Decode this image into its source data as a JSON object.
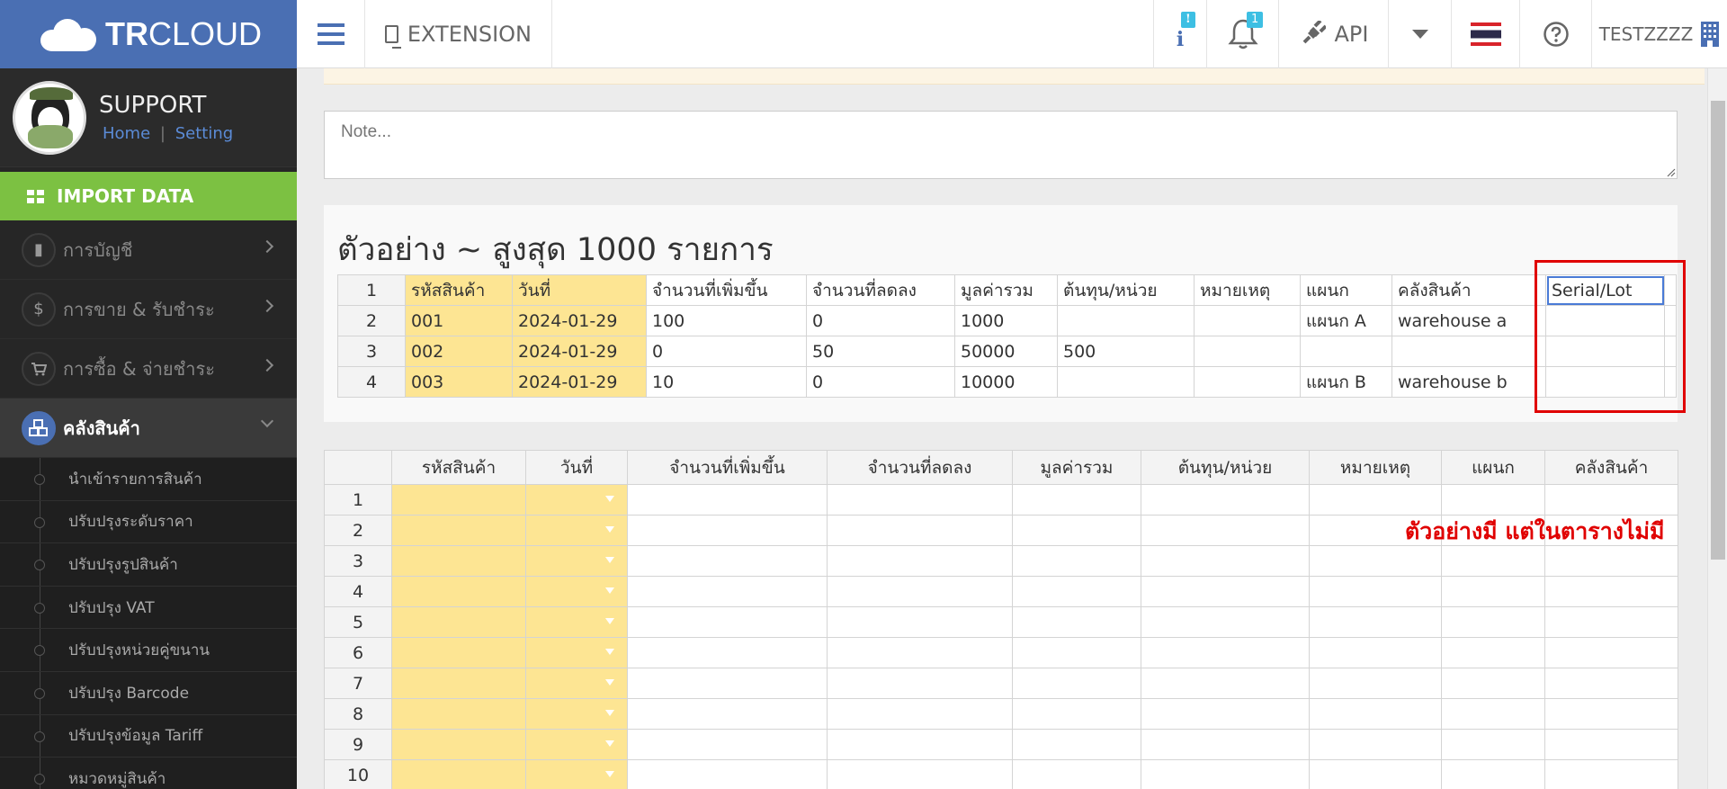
{
  "logo": {
    "part1": "TR",
    "part2": "CLOUD"
  },
  "topbar": {
    "extension_label": "EXTENSION",
    "info_badge": "!",
    "notification_badge": "1",
    "api_label": "API",
    "username": "TESTZZZZ"
  },
  "profile": {
    "name": "SUPPORT",
    "home_link": "Home",
    "separator": "|",
    "setting_link": "Setting"
  },
  "sidebar": {
    "import_data": "IMPORT DATA",
    "menus": [
      {
        "label": "การบัญชี",
        "icon": "book-icon"
      },
      {
        "label": "การขาย & รับชำระ",
        "icon": "dollar-icon"
      },
      {
        "label": "การซื้อ & จ่ายชำระ",
        "icon": "cart-icon"
      }
    ],
    "warehouse": "คลังสินค้า",
    "sub_items": [
      "นำเข้ารายการสินค้า",
      "ปรับปรุงระดับราคา",
      "ปรับปรุงรูปสินค้า",
      "ปรับปรุง VAT",
      "ปรับปรุงหน่วยคู่ขนาน",
      "ปรับปรุง Barcode",
      "ปรับปรุงข้อมูล Tariff",
      "หมวดหมู่สินค้า"
    ]
  },
  "note": {
    "placeholder": "Note..."
  },
  "sample": {
    "title": "ตัวอย่าง ~ สูงสุด 1000 รายการ",
    "rows": [
      {
        "n": "1",
        "cells": [
          "รหัสสินค้า",
          "วันที่",
          "จำนวนที่เพิ่มขึ้น",
          "จำนวนที่ลดลง",
          "มูลค่ารวม",
          "ต้นทุน/หน่วย",
          "หมายเหตุ",
          "แผนก",
          "คลังสินค้า",
          "Serial/Lot"
        ]
      },
      {
        "n": "2",
        "cells": [
          "001",
          "2024-01-29",
          "100",
          "0",
          "1000",
          "",
          "",
          "แผนก A",
          "warehouse a",
          ""
        ]
      },
      {
        "n": "3",
        "cells": [
          "002",
          "2024-01-29",
          "0",
          "50",
          "50000",
          "500",
          "",
          "",
          "",
          ""
        ]
      },
      {
        "n": "4",
        "cells": [
          "003",
          "2024-01-29",
          "10",
          "0",
          "10000",
          "",
          "",
          "แผนก B",
          "warehouse b",
          ""
        ]
      }
    ]
  },
  "grid": {
    "headers": [
      "รหัสสินค้า",
      "วันที่",
      "จำนวนที่เพิ่มขึ้น",
      "จำนวนที่ลดลง",
      "มูลค่ารวม",
      "ต้นทุน/หน่วย",
      "หมายเหตุ",
      "แผนก",
      "คลังสินค้า"
    ],
    "row_numbers": [
      "1",
      "2",
      "3",
      "4",
      "5",
      "6",
      "7",
      "8",
      "9",
      "10"
    ]
  },
  "annotation": "ตัวอย่างมี แต่ในตารางไม่มี",
  "colors": {
    "brand": "#4a6fb3",
    "import_green": "#7cc142",
    "highlight_yellow": "#fde593",
    "annotation_red": "#e00000"
  }
}
